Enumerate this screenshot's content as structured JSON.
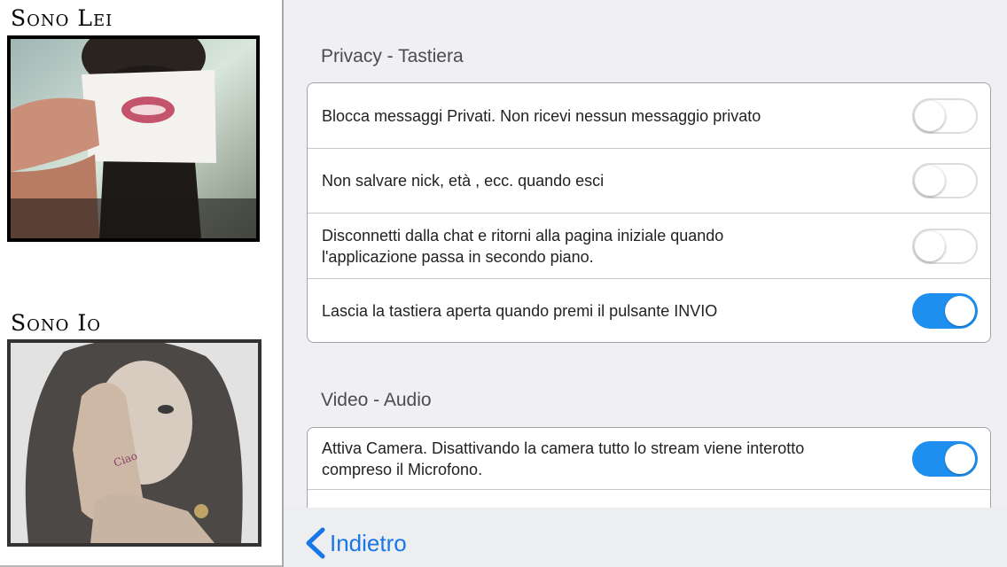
{
  "left": {
    "her_title": "Sono Lei",
    "me_title": "Sono Io"
  },
  "sections": [
    {
      "header": "Privacy - Tastiera",
      "rows": [
        {
          "label": "Blocca messaggi Privati. Non ricevi nessun messaggio privato",
          "on": false
        },
        {
          "label": "Non salvare nick, età , ecc. quando esci",
          "on": false
        },
        {
          "label": "Disconnetti dalla chat e ritorni alla pagina iniziale quando l'applicazione passa in secondo piano.",
          "on": false
        },
        {
          "label": "Lascia la tastiera aperta quando premi il pulsante INVIO",
          "on": true
        }
      ]
    },
    {
      "header": "Video - Audio",
      "rows": [
        {
          "label": "Attiva Camera. Disattivando la camera tutto lo stream viene interotto compreso il Microfono.",
          "on": true
        },
        {
          "label": "",
          "on": null
        }
      ]
    }
  ],
  "footer": {
    "back_label": "Indietro"
  },
  "colors": {
    "toggle_on": "#1e8fef",
    "link": "#1976e8"
  }
}
